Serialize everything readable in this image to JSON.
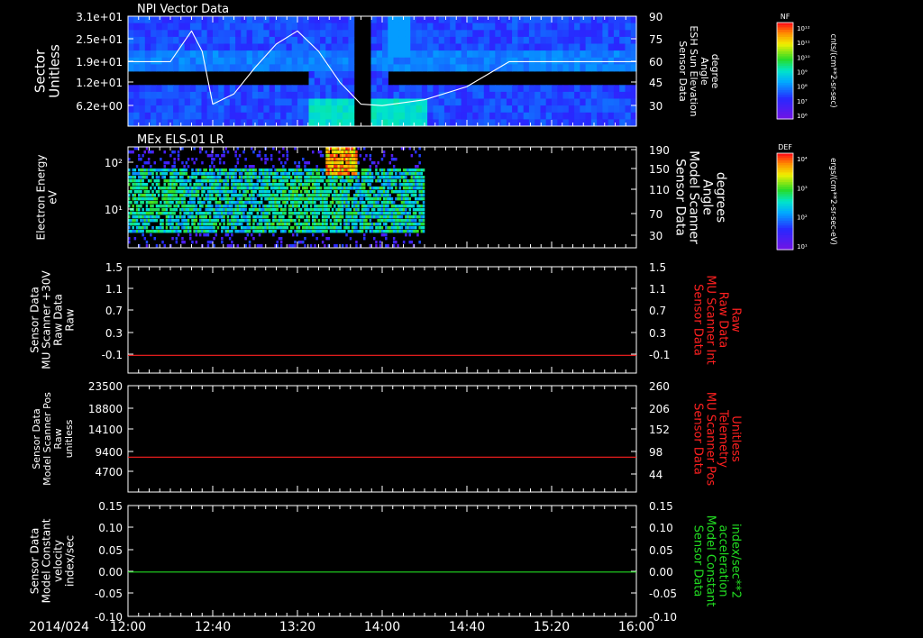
{
  "date_label": "2014/024",
  "time_ticks": [
    "12:00",
    "12:40",
    "13:20",
    "14:00",
    "14:40",
    "15:20",
    "16:00"
  ],
  "colors": {
    "background": "#000000",
    "axis": "#ffffff",
    "red_trace": "#ff2020",
    "green_trace": "#22dd22"
  },
  "colorbars": [
    {
      "name": "NF",
      "unit_label": "cnts/(cm**2-sr-sec)",
      "ticks": [
        "10¹²",
        "10¹¹",
        "10¹⁰",
        "10⁹",
        "10⁸",
        "10⁷",
        "10⁶"
      ]
    },
    {
      "name": "DEF",
      "unit_label": "ergs/(cm**2-sr-sec-eV)",
      "ticks": [
        "10⁴",
        "10³",
        "10²",
        "10¹"
      ]
    }
  ],
  "chart_data": [
    {
      "type": "heatmap",
      "title": "NPI Vector Data",
      "ylabel_left": [
        "Sector",
        "Unitless"
      ],
      "yticks_left": [
        "3.1e+01",
        "2.5e+01",
        "1.9e+01",
        "1.2e+01",
        "6.2e+00"
      ],
      "ylabel_right": [
        "Sensor Data",
        "ESH Sun Elevation",
        "Angle",
        "degree"
      ],
      "yticks_right": [
        "90",
        "75",
        "60",
        "45",
        "30"
      ],
      "ylim_right": [
        15,
        90
      ],
      "overlay_line": {
        "name": "ESH Sun Elevation Angle",
        "x": [
          "12:00",
          "12:20",
          "12:30",
          "12:35",
          "12:40",
          "12:50",
          "13:00",
          "13:10",
          "13:20",
          "13:30",
          "13:40",
          "13:50",
          "14:00",
          "14:20",
          "14:40",
          "15:00",
          "16:00"
        ],
        "y": [
          59,
          59,
          80,
          66,
          30,
          37,
          55,
          71,
          80,
          66,
          45,
          30,
          29,
          33,
          42,
          59,
          59
        ]
      },
      "data_gaps": [
        "13:47-13:54"
      ]
    },
    {
      "type": "heatmap",
      "title": "MEx ELS-01 LR",
      "ylabel_left": [
        "Electron Energy",
        "eV"
      ],
      "yticks_left": [
        "10²",
        "10¹"
      ],
      "ylabel_right": [
        "Sensor Data",
        "Model Scanner",
        "Angle",
        "degrees"
      ],
      "yticks_right": [
        "190",
        "150",
        "110",
        "70",
        "30"
      ],
      "ylim_right": [
        10,
        190
      ],
      "overlay_line": {
        "name": "Model Scanner Angle",
        "x": [
          "12:00",
          "16:00"
        ],
        "y": [
          10,
          10
        ]
      },
      "data_extent": [
        "12:00",
        "14:20"
      ]
    },
    {
      "type": "line",
      "ylabel_left": [
        "Sensor Data",
        "MU Scanner +30V",
        "Raw Data",
        "Raw"
      ],
      "yticks_left": [
        "1.5",
        "1.1",
        "0.7",
        "0.3",
        "-0.1"
      ],
      "ylabel_right": [
        "Sensor Data",
        "MU Scanner Int",
        "Raw Data",
        "Raw"
      ],
      "yticks_right": [
        "1.5",
        "1.1",
        "0.7",
        "0.3",
        "-0.1"
      ],
      "ylim": [
        -0.3,
        1.5
      ],
      "series": [
        {
          "x": [
            "12:00",
            "16:00"
          ],
          "y": [
            0,
            0
          ]
        }
      ]
    },
    {
      "type": "line",
      "ylabel_left": [
        "Sensor Data",
        "Model Scanner Pos",
        "Raw",
        "unitless"
      ],
      "yticks_left": [
        "23500",
        "18800",
        "14100",
        "9400",
        "4700"
      ],
      "ylabel_right": [
        "Sensor Data",
        "MU Scanner Pos",
        "Telemetry",
        "Unitless"
      ],
      "yticks_right": [
        "260",
        "206",
        "152",
        "98",
        "44"
      ],
      "ylim": [
        0,
        23500
      ],
      "series": [
        {
          "x": [
            "12:00",
            "16:00"
          ],
          "y": [
            7700,
            7700
          ]
        }
      ]
    },
    {
      "type": "line",
      "ylabel_left": [
        "Sensor Data",
        "Model Constant",
        "velocity",
        "index/sec"
      ],
      "yticks_left": [
        "0.15",
        "0.10",
        "0.05",
        "0.00",
        "-0.05",
        "-0.10"
      ],
      "ylabel_right": [
        "Sensor Data",
        "Model Constant",
        "acceleration",
        "index/sec**2"
      ],
      "yticks_right": [
        "0.15",
        "0.10",
        "0.05",
        "0.00",
        "-0.05",
        "-0.10"
      ],
      "ylim": [
        -0.1,
        0.15
      ],
      "series": [
        {
          "x": [
            "12:00",
            "16:00"
          ],
          "y": [
            0,
            0
          ]
        }
      ]
    }
  ]
}
